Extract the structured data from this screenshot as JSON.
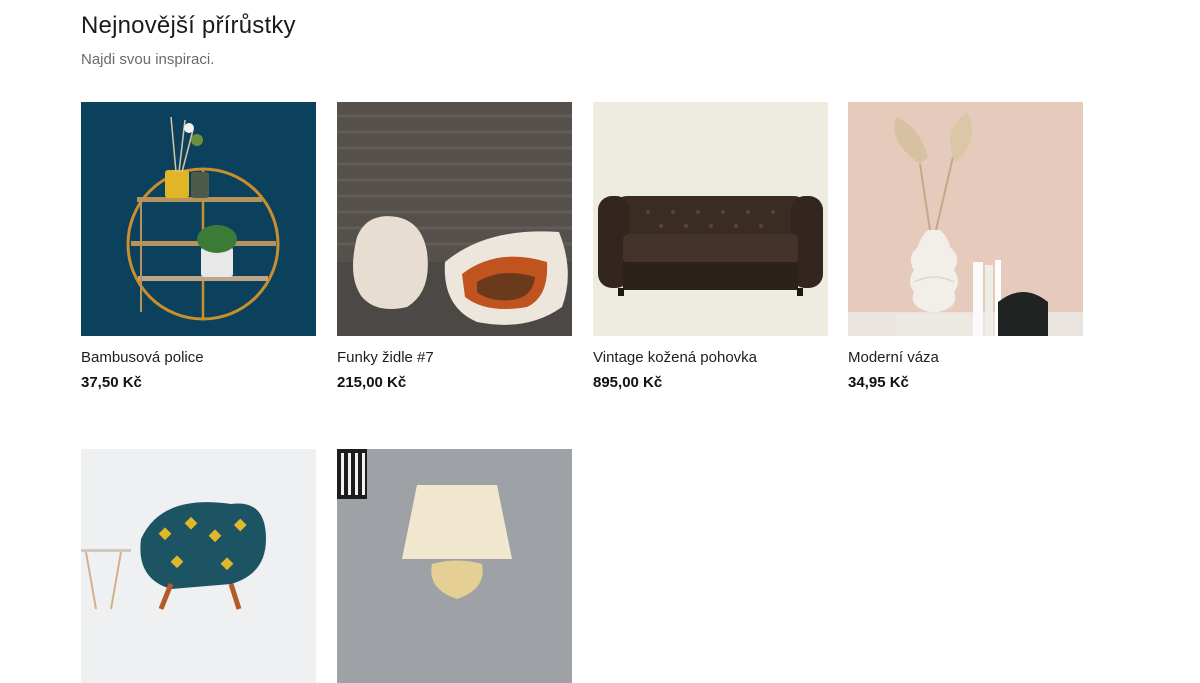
{
  "section": {
    "title": "Nejnovější přírůstky",
    "subtitle": "Najdi svou inspiraci."
  },
  "products": [
    {
      "name": "Bambusová police",
      "price": "37,50 Kč",
      "image": "round-gold-wall-shelf"
    },
    {
      "name": "Funky židle #7",
      "price": "215,00 Kč",
      "image": "white-sculptural-chairs"
    },
    {
      "name": "Vintage kožená pohovka",
      "price": "895,00 Kč",
      "image": "leather-chesterfield-sofa"
    },
    {
      "name": "Moderní váza",
      "price": "34,95 Kč",
      "image": "white-vase-with-dried-palm"
    },
    {
      "image": "patterned-armchair"
    },
    {
      "image": "table-lamp"
    }
  ]
}
